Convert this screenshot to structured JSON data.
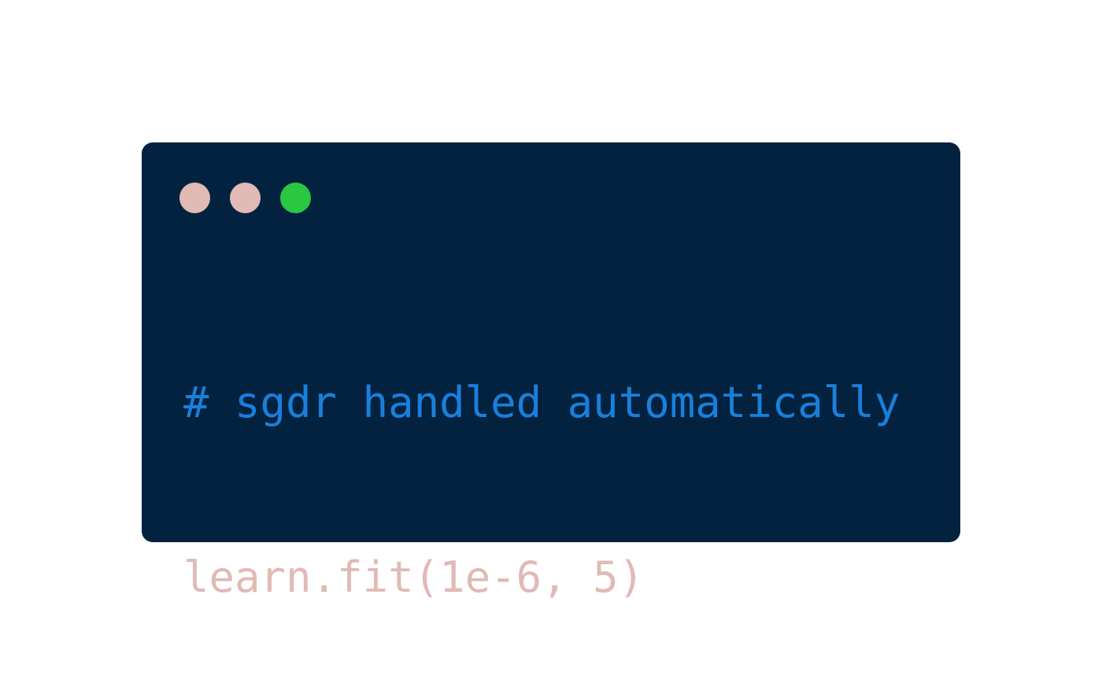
{
  "window": {
    "background": "#022240",
    "controls": [
      {
        "name": "close",
        "color": "#e0bab5"
      },
      {
        "name": "minimize",
        "color": "#e0bab5"
      },
      {
        "name": "maximize",
        "color": "#2ac840"
      }
    ]
  },
  "code": {
    "comment": "# sgdr handled automatically",
    "comment_color": "#1a7fdb",
    "statement": "learn.fit(1e-6, 5)",
    "statement_color": "#e0bab5"
  }
}
